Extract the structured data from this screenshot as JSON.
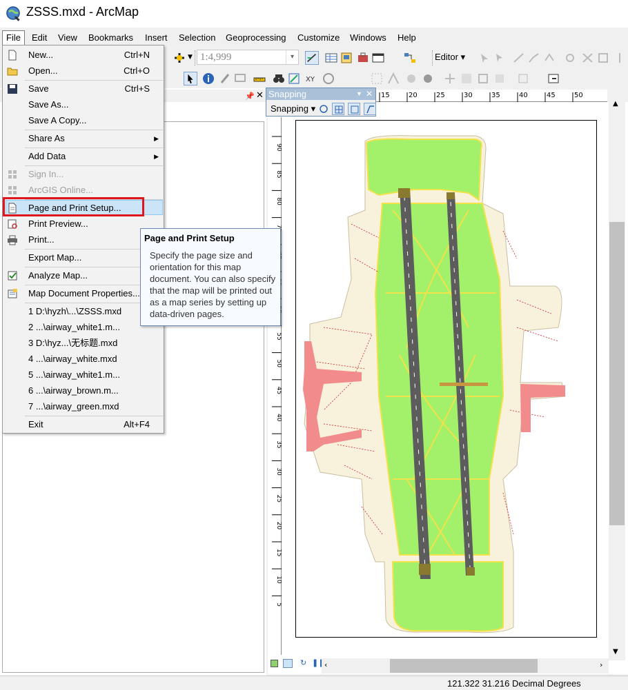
{
  "window": {
    "title": "ZSSS.mxd - ArcMap"
  },
  "menubar": [
    "File",
    "Edit",
    "View",
    "Bookmarks",
    "Insert",
    "Selection",
    "Geoprocessing",
    "Customize",
    "Windows",
    "Help"
  ],
  "toolbar": {
    "scale": "1:4,999",
    "editor_label": "Editor"
  },
  "snapping": {
    "title": "Snapping",
    "label": "Snapping"
  },
  "file_menu": {
    "new": {
      "label": "New...",
      "shortcut": "Ctrl+N"
    },
    "open": {
      "label": "Open...",
      "shortcut": "Ctrl+O"
    },
    "save": {
      "label": "Save",
      "shortcut": "Ctrl+S"
    },
    "save_as": {
      "label": "Save As..."
    },
    "save_copy": {
      "label": "Save A Copy..."
    },
    "share_as": {
      "label": "Share As"
    },
    "add_data": {
      "label": "Add Data"
    },
    "sign_in": {
      "label": "Sign In..."
    },
    "arcgis_online": {
      "label": "ArcGIS Online..."
    },
    "page_setup": {
      "label": "Page and Print Setup..."
    },
    "print_preview": {
      "label": "Print Preview..."
    },
    "print": {
      "label": "Print..."
    },
    "export_map": {
      "label": "Export Map..."
    },
    "analyze_map": {
      "label": "Analyze Map..."
    },
    "map_doc_props": {
      "label": "Map Document Properties..."
    },
    "recent": [
      "1 D:\\hyzh\\...\\ZSSS.mxd",
      "2 ...\\airway_white1.m...",
      "3 D:\\hyz...\\无标题.mxd",
      "4 ...\\airway_white.mxd",
      "5 ...\\airway_white1.m...",
      "6 ...\\airway_brown.m...",
      "7 ...\\airway_green.mxd"
    ],
    "exit": {
      "label": "Exit",
      "shortcut": "Alt+F4"
    }
  },
  "tooltip": {
    "title": "Page and Print Setup",
    "body": "Specify the page size and orientation for this map document. You can also specify that the map will be printed out as a map series by setting up data-driven pages."
  },
  "ruler_top": [
    "15",
    "20",
    "25",
    "30",
    "35",
    "40",
    "45",
    "50"
  ],
  "ruler_left": [
    "90",
    "85",
    "80",
    "75",
    "70",
    "65",
    "60",
    "55",
    "50",
    "45",
    "40",
    "35",
    "30",
    "25",
    "20",
    "15",
    "10",
    "5"
  ],
  "status": {
    "coords": "121.322  31.216 Decimal Degrees"
  },
  "colors": {
    "grass": "#a3f06b",
    "apron": "#f8f2dc",
    "terminal": "#f28c8c",
    "runway": "#5c5c5c",
    "highlight": "#cce4f7",
    "red_box": "#e0161d"
  }
}
